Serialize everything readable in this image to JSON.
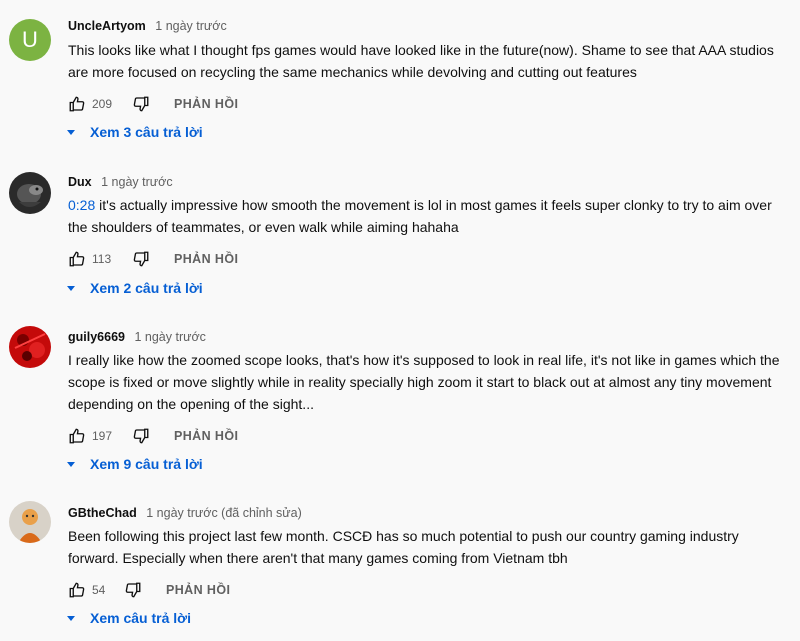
{
  "comments": [
    {
      "author": "UncleArtyom",
      "time": "1 ngày trước",
      "avatar_letter": "U",
      "text": "This looks like what I thought fps games would have looked like in the future(now). Shame to see that AAA studios are more focused on recycling the same mechanics while devolving and cutting out features",
      "likes": "209",
      "reply_label": "PHẢN HỒI",
      "replies_label": "Xem 3 câu trả lời"
    },
    {
      "author": "Dux",
      "time": "1 ngày trước",
      "timestamp": "0:28",
      "text": " it's actually impressive how smooth the movement is lol in most games it feels super clonky to try to aim over the shoulders of teammates, or even walk while aiming hahaha",
      "likes": "113",
      "reply_label": "PHẢN HỒI",
      "replies_label": "Xem 2 câu trả lời"
    },
    {
      "author": "guily6669",
      "time": "1 ngày trước",
      "text": "I really like how the zoomed scope looks, that's how it's supposed to look in real life, it's not like in games which the scope is fixed or move slightly while in reality specially high zoom it start to black out at almost any tiny movement depending on the opening of the sight...",
      "likes": "197",
      "reply_label": "PHẢN HỒI",
      "replies_label": "Xem 9 câu trả lời"
    },
    {
      "author": "GBtheChad",
      "time": "1 ngày trước (đã chỉnh sửa)",
      "text": "Been following this project last few month. CSCĐ has so much potential to push our country gaming industry forward. Especially when there aren't that many games coming from Vietnam tbh",
      "likes": "54",
      "reply_label": "PHẢN HỒI",
      "replies_label": "Xem câu trả lời"
    }
  ],
  "colors": {
    "link": "#065fd4",
    "secondary_text": "#606060",
    "avatar_u": "#7cb342"
  }
}
